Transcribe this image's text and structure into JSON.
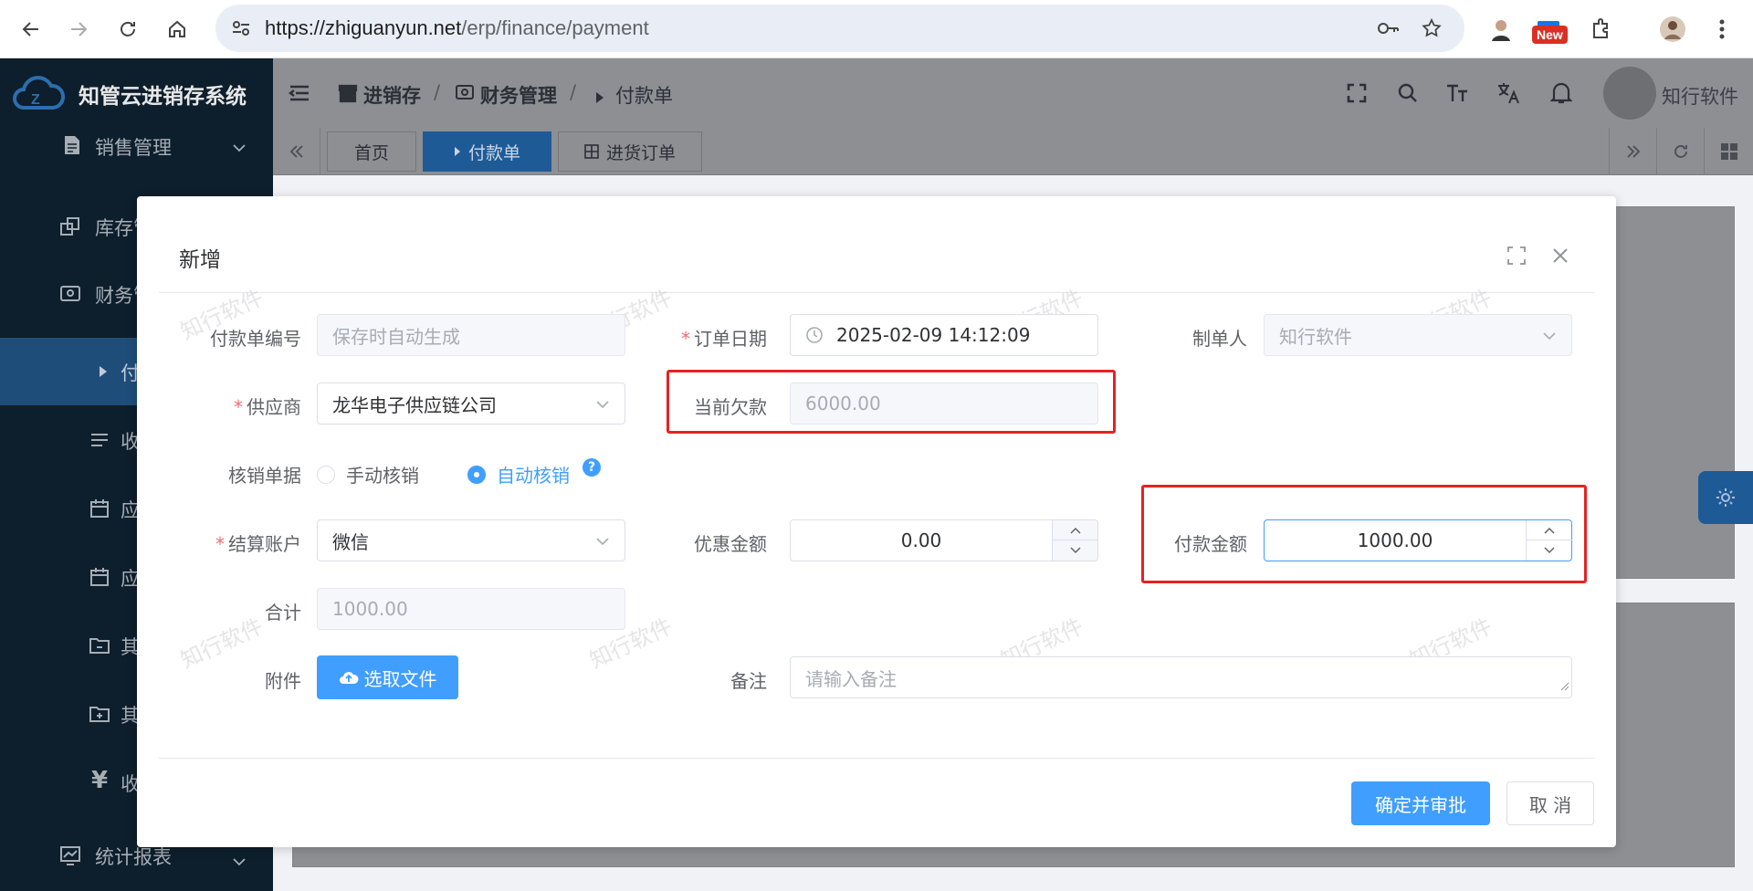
{
  "browser": {
    "url_host": "https://zhiguanyun.net",
    "url_path": "/erp/finance/payment",
    "new_badge": "New"
  },
  "app": {
    "title": "知管云进销存系统",
    "user_name": "知行软件",
    "breadcrumb": [
      "进销存",
      "财务管理",
      "付款单"
    ]
  },
  "tabs": [
    {
      "label": "首页",
      "active": false
    },
    {
      "label": "付款单",
      "active": true
    },
    {
      "label": "进货订单",
      "active": false
    }
  ],
  "sidebar": {
    "items": [
      {
        "label": "销售管理"
      },
      {
        "label": "库存管"
      },
      {
        "label": "财务管"
      },
      {
        "label": "付"
      },
      {
        "label": "收"
      },
      {
        "label": "应"
      },
      {
        "label": "应"
      },
      {
        "label": "其"
      },
      {
        "label": "其"
      },
      {
        "label": "收"
      },
      {
        "label": "统计报表"
      }
    ]
  },
  "dialog": {
    "title": "新增",
    "fields": {
      "payment_no": {
        "label": "付款单编号",
        "placeholder": "保存时自动生成"
      },
      "order_date": {
        "label": "订单日期",
        "value": "2025-02-09 14:12:09"
      },
      "creator": {
        "label": "制单人",
        "value": "知行软件"
      },
      "supplier": {
        "label": "供应商",
        "value": "龙华电子供应链公司"
      },
      "current_debt": {
        "label": "当前欠款",
        "value": "6000.00"
      },
      "writeoff": {
        "label": "核销单据",
        "options": [
          "手动核销",
          "自动核销"
        ],
        "selected": "自动核销"
      },
      "account": {
        "label": "结算账户",
        "value": "微信"
      },
      "discount": {
        "label": "优惠金额",
        "value": "0.00"
      },
      "payment_amount": {
        "label": "付款金额",
        "value": "1000.00"
      },
      "total": {
        "label": "合计",
        "value": "1000.00"
      },
      "attachment": {
        "label": "附件",
        "button": "选取文件"
      },
      "remark": {
        "label": "备注",
        "placeholder": "请输入备注"
      }
    },
    "buttons": {
      "confirm": "确定并审批",
      "cancel": "取 消"
    }
  },
  "watermark_text": "知行软件",
  "colors": {
    "primary": "#409eff",
    "highlight": "#e62222",
    "sidebar_bg": "#0d1e2c"
  }
}
